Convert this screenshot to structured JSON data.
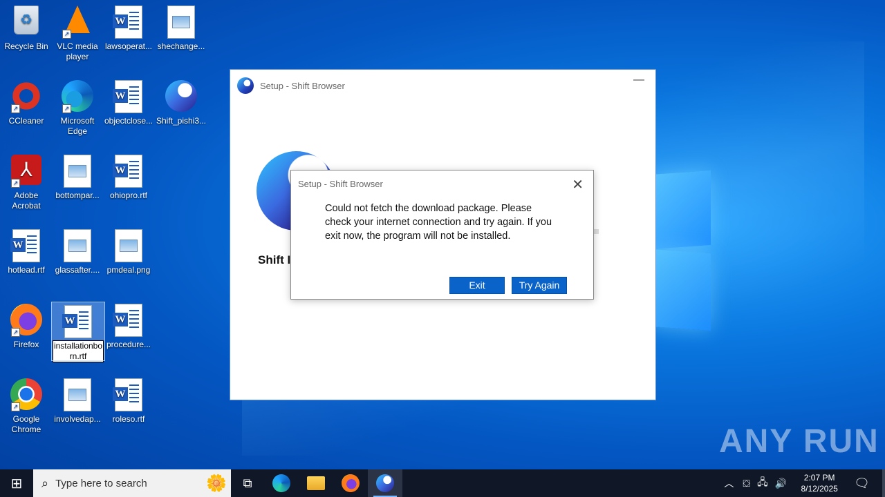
{
  "desktop": {
    "icons": {
      "recycle_bin": "Recycle Bin",
      "vlc": "VLC media player",
      "lawsoperat": "lawsoperat...",
      "shechange": "shechange...",
      "ccleaner": "CCleaner",
      "edge": "Microsoft Edge",
      "objectclose": "objectclose...",
      "shift_pishi": "Shift_pishi3...",
      "acrobat": "Adobe Acrobat",
      "bottompar": "bottompar...",
      "ohiopro": "ohiopro.rtf",
      "hotlead": "hotlead.rtf",
      "glassafter": "glassafter....",
      "pmdeal": "pmdeal.png",
      "firefox": "Firefox",
      "installationborn": "installationborn.rtf",
      "procedure": "procedure...",
      "chrome": "Google Chrome",
      "involvedap": "involvedap...",
      "roleso": "roleso.rtf"
    }
  },
  "setup_window": {
    "title": "Setup - Shift Browser",
    "app_name": "Shift I"
  },
  "dialog": {
    "title": "Setup - Shift Browser",
    "message": "Could not fetch the download package. Please check your internet connection and try again. If you exit now, the program will not be installed.",
    "exit_label": "Exit",
    "retry_label": "Try Again"
  },
  "taskbar": {
    "search_placeholder": "Type here to search",
    "time": "2:07 PM",
    "date": "8/12/2025"
  },
  "watermark": "ANY RUN",
  "colors": {
    "accent": "#0a63c9",
    "taskbar": "#101828"
  }
}
